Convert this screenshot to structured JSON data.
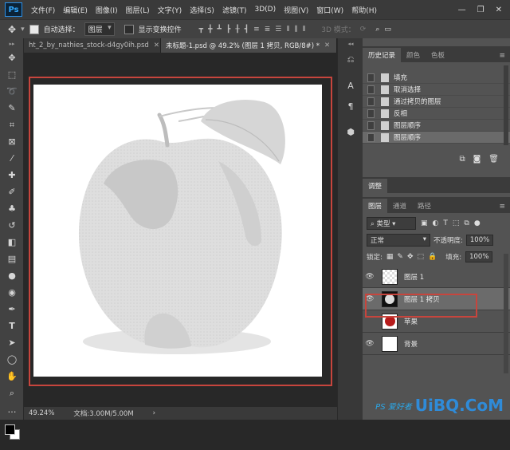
{
  "menu": {
    "logo": "Ps",
    "items": [
      "文件(F)",
      "编辑(E)",
      "图像(I)",
      "图层(L)",
      "文字(Y)",
      "选择(S)",
      "滤镜(T)",
      "3D(D)",
      "视图(V)",
      "窗口(W)",
      "帮助(H)"
    ]
  },
  "options": {
    "auto_select_label": "自动选择：",
    "auto_select_value": "图层",
    "show_transform_label": "显示变换控件",
    "mode_3d": "3D 模式："
  },
  "tabs": [
    {
      "label": "ht_2_by_nathies_stock-d4gy0ih.psd"
    },
    {
      "label": "未标题-1.psd @ 49.2% (图层 1 拷贝, RGB/8#) *"
    }
  ],
  "status": {
    "zoom": "49.24%",
    "doc": "文档:3.00M/5.00M"
  },
  "history": {
    "tabs": [
      "历史记录",
      "颜色",
      "色板"
    ],
    "items": [
      "填充",
      "取消选择",
      "通过拷贝的图层",
      "反相",
      "图层顺序",
      "图层顺序"
    ],
    "selected_index": 5
  },
  "adjust_tab": "调整",
  "layers_panel": {
    "tabs": [
      "图层",
      "通道",
      "路径"
    ],
    "filter_kind": "类型",
    "blend_mode": "正常",
    "opacity_label": "不透明度:",
    "opacity_value": "100%",
    "lock_label": "锁定:",
    "fill_label": "填充:",
    "fill_value": "100%",
    "layers": [
      {
        "name": "图层 1",
        "visible": true,
        "selected": false
      },
      {
        "name": "图层 1 拷贝",
        "visible": true,
        "selected": true
      },
      {
        "name": "苹果",
        "visible": false,
        "selected": false
      },
      {
        "name": "背景",
        "visible": true,
        "selected": false
      }
    ]
  },
  "watermark": {
    "brand": "PS 爱好者",
    "site": "UiBQ.CoM"
  },
  "colors": {
    "accent_red": "#c7453d",
    "apple_red": "#b71c1c",
    "ps_blue": "#31a8ff"
  }
}
